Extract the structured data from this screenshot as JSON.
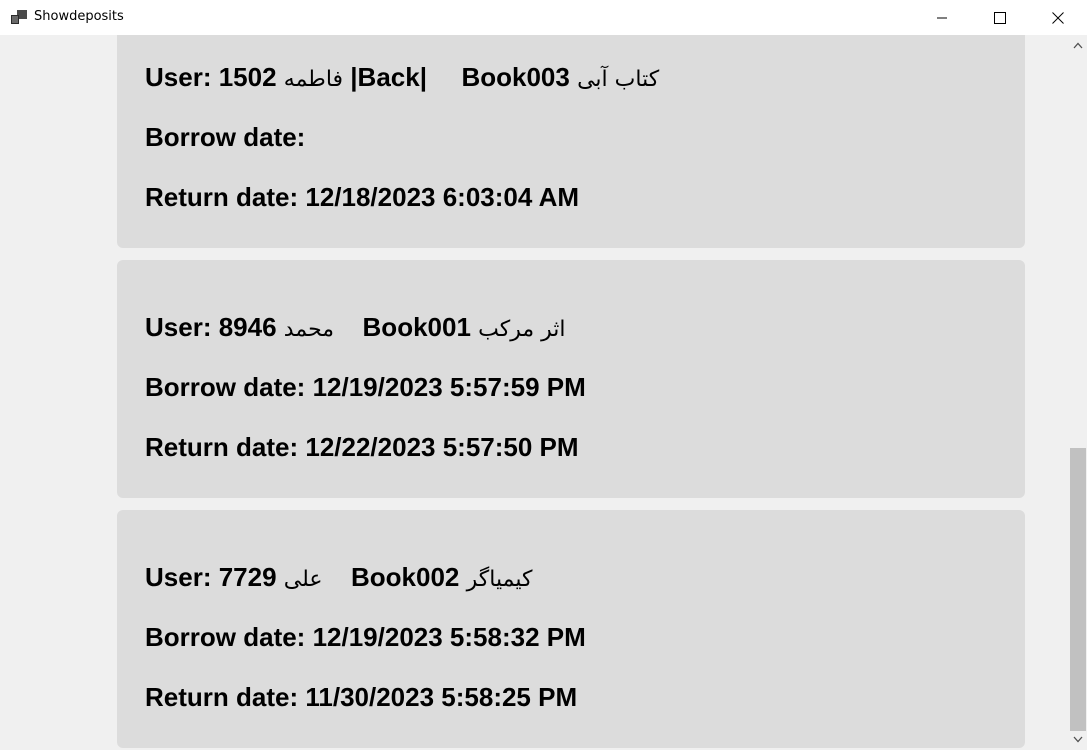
{
  "window": {
    "title": "Showdeposits",
    "controls": {
      "minimize_icon": "minimize-icon",
      "maximize_icon": "maximize-icon",
      "close_icon": "close-icon"
    }
  },
  "deposits": [
    {
      "user_label": "User:",
      "user_id": "1502",
      "user_name": "فاطمه",
      "status": "|Back|",
      "book_id": "Book003",
      "book_title": "کتاب آبی",
      "borrow_label": "Borrow date:",
      "borrow_date": "",
      "return_label": "Return date:",
      "return_date": "12/18/2023 6:03:04 AM"
    },
    {
      "user_label": "User:",
      "user_id": "8946",
      "user_name": "محمد",
      "book_id": "Book001",
      "book_title": "اثر مرکب",
      "borrow_label": "Borrow date:",
      "borrow_date": "12/19/2023 5:57:59 PM",
      "return_label": "Return date:",
      "return_date": "12/22/2023 5:57:50 PM"
    },
    {
      "user_label": "User:",
      "user_id": "7729",
      "user_name": "علی",
      "book_id": "Book002",
      "book_title": "کیمیاگر",
      "borrow_label": "Borrow date:",
      "borrow_date": "12/19/2023 5:58:32 PM",
      "return_label": "Return date:",
      "return_date": "11/30/2023 5:58:25 PM"
    }
  ]
}
